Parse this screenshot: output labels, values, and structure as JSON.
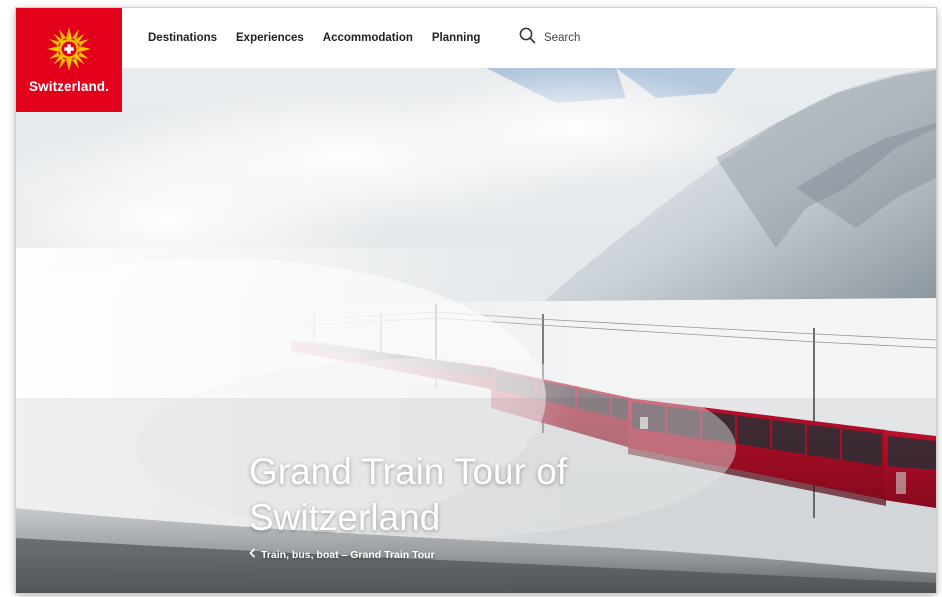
{
  "brand": {
    "logo_text": "Switzerland.",
    "red": "#e2001a"
  },
  "nav": {
    "items": [
      "Destinations",
      "Experiences",
      "Accommodation",
      "Planning"
    ],
    "search_label": "Search",
    "search_icon": "search-icon"
  },
  "hero": {
    "title": "Grand Train Tour of Switzerland",
    "breadcrumb": "Train, bus, boat – Grand Train Tour",
    "breadcrumb_icon": "chevron-left-icon",
    "image": "red-panoramic-train-in-snowy-alps"
  }
}
